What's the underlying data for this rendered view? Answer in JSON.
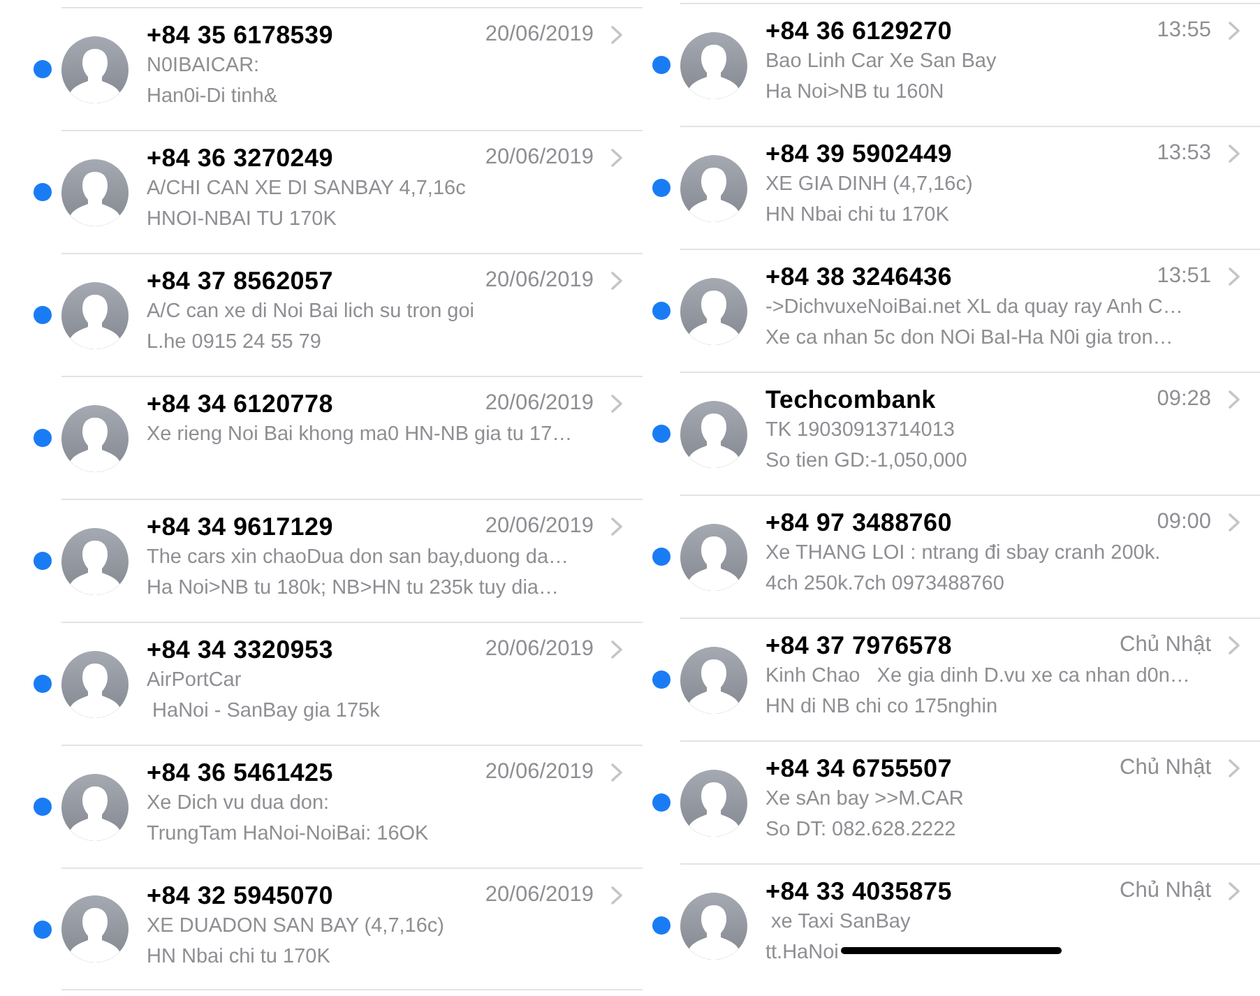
{
  "panes": [
    {
      "messages": [
        {
          "name": "+84 35 6178539",
          "time": "20/06/2019",
          "unread": true,
          "lines": [
            "N0IBAICAR:",
            "Han0i-Di tinh&"
          ]
        },
        {
          "name": "+84 36 3270249",
          "time": "20/06/2019",
          "unread": true,
          "lines": [
            "A/CHI CAN XE DI SANBAY 4,7,16c",
            "HNOI-NBAI TU 170K"
          ]
        },
        {
          "name": "+84 37 8562057",
          "time": "20/06/2019",
          "unread": true,
          "lines": [
            "A/C can xe di Noi Bai lich su tron goi",
            "L.he 0915 24 55 79"
          ]
        },
        {
          "name": "+84 34 6120778",
          "time": "20/06/2019",
          "unread": true,
          "lines": [
            "Xe rieng Noi Bai khong ma0 HN-NB gia tu 17…"
          ]
        },
        {
          "name": "+84 34 9617129",
          "time": "20/06/2019",
          "unread": true,
          "lines": [
            "The cars xin chaoDua don san bay,duong da…",
            "Ha Noi>NB tu 180k; NB>HN tu 235k tuy dia…"
          ]
        },
        {
          "name": "+84 34 3320953",
          "time": "20/06/2019",
          "unread": true,
          "lines": [
            "AirPortCar",
            " HaNoi - SanBay gia 175k"
          ]
        },
        {
          "name": "+84 36 5461425",
          "time": "20/06/2019",
          "unread": true,
          "lines": [
            "Xe Dich vu dua don:",
            "TrungTam HaNoi-NoiBai: 16OK"
          ]
        },
        {
          "name": "+84 32 5945070",
          "time": "20/06/2019",
          "unread": true,
          "lines": [
            "XE DUADON SAN BAY (4,7,16c)",
            "HN Nbai chi tu 170K"
          ]
        }
      ]
    },
    {
      "messages": [
        {
          "name": "+84 36 6129270",
          "time": "13:55",
          "unread": true,
          "lines": [
            "Bao Linh Car Xe San Bay",
            "Ha Noi>NB tu 160N"
          ]
        },
        {
          "name": "+84 39 5902449",
          "time": "13:53",
          "unread": true,
          "lines": [
            "XE GIA DINH (4,7,16c)",
            "HN Nbai chi tu 170K"
          ]
        },
        {
          "name": "+84 38 3246436",
          "time": "13:51",
          "unread": true,
          "lines": [
            "->DichvuxeNoiBai.net XL da quay ray Anh C…",
            "Xe ca nhan 5c don NOi BaI-Ha N0i gia tron…"
          ]
        },
        {
          "name": "Techcombank",
          "time": "09:28",
          "unread": true,
          "lines": [
            "TK 19030913714013",
            "So tien GD:-1,050,000"
          ]
        },
        {
          "name": "+84 97 3488760",
          "time": "09:00",
          "unread": true,
          "lines": [
            "Xe THANG LOI : ntrang đi sbay cranh 200k.",
            "4ch 250k.7ch 0973488760"
          ]
        },
        {
          "name": "+84 37 7976578",
          "time": "Chủ Nhật",
          "unread": true,
          "lines": [
            "Kinh Chao   Xe gia dinh D.vu xe ca nhan d0n…",
            "HN di NB chi co 175nghin"
          ]
        },
        {
          "name": "+84 34 6755507",
          "time": "Chủ Nhật",
          "unread": true,
          "lines": [
            "Xe sAn bay >>M.CAR",
            "So DT: 082.628.2222"
          ]
        },
        {
          "name": "+84 33 4035875",
          "time": "Chủ Nhật",
          "unread": true,
          "lines": [
            " xe Taxi SanBay",
            "tt.HaNoi"
          ]
        }
      ]
    }
  ]
}
